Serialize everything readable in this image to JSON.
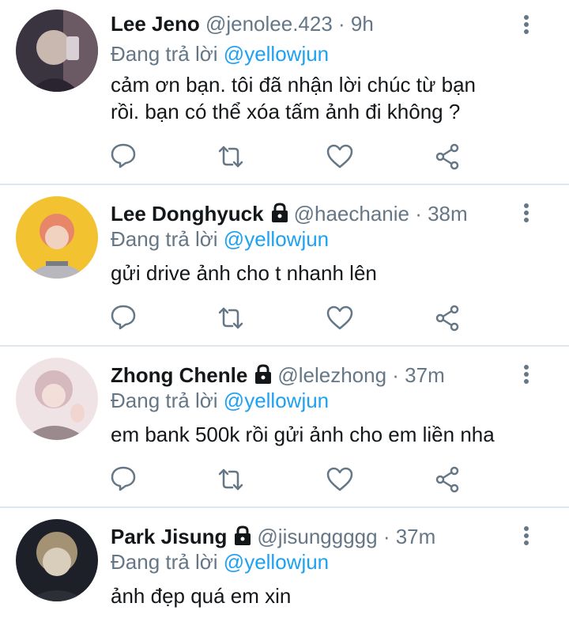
{
  "tweets": [
    {
      "name": "Lee Jeno",
      "handle": "@jenolee.423",
      "time": "· 9h",
      "locked": false,
      "reply_prefix": "Đang trả lời",
      "reply_to": "@yellowjun",
      "text_lines": [
        "cảm ơn bạn. tôi đã nhận lời chúc từ bạn",
        "rồi. bạn có thể xóa tấm ảnh đi không ?"
      ],
      "avatar_colors": [
        "#3a3340",
        "#c9b8b0",
        "#6b5a63"
      ]
    },
    {
      "name": "Lee Donghyuck",
      "handle": "@haechanie",
      "time": "· 38m",
      "locked": true,
      "reply_prefix": "Đang trả lời",
      "reply_to": "@yellowjun",
      "text_lines": [
        "gửi drive ảnh cho t nhanh lên"
      ],
      "avatar_colors": [
        "#f2c230",
        "#e8866a",
        "#b7b7bd"
      ]
    },
    {
      "name": "Zhong Chenle",
      "handle": "@lelezhong",
      "time": "· 37m",
      "locked": true,
      "reply_prefix": "Đang trả lời",
      "reply_to": "@yellowjun",
      "text_lines": [
        "em bank 500k rồi gửi ảnh cho em liền nha"
      ],
      "avatar_colors": [
        "#efe3e6",
        "#d6b9be",
        "#9a8a8e"
      ]
    },
    {
      "name": "Park Jisung",
      "handle": "@jisunggggg",
      "time": "· 37m",
      "locked": true,
      "reply_prefix": "Đang trả lời",
      "reply_to": "@yellowjun",
      "text_lines": [
        "ảnh đẹp quá em xin"
      ],
      "avatar_colors": [
        "#1d2028",
        "#a39274",
        "#d9cdbb"
      ]
    }
  ],
  "icons": [
    "comment-icon",
    "retweet-icon",
    "like-icon",
    "share-icon",
    "more-icon",
    "lock-icon"
  ],
  "colors": {
    "accent": "#1da1f2",
    "muted": "#657786",
    "text": "#14171a",
    "divider": "#e1e8ed"
  }
}
